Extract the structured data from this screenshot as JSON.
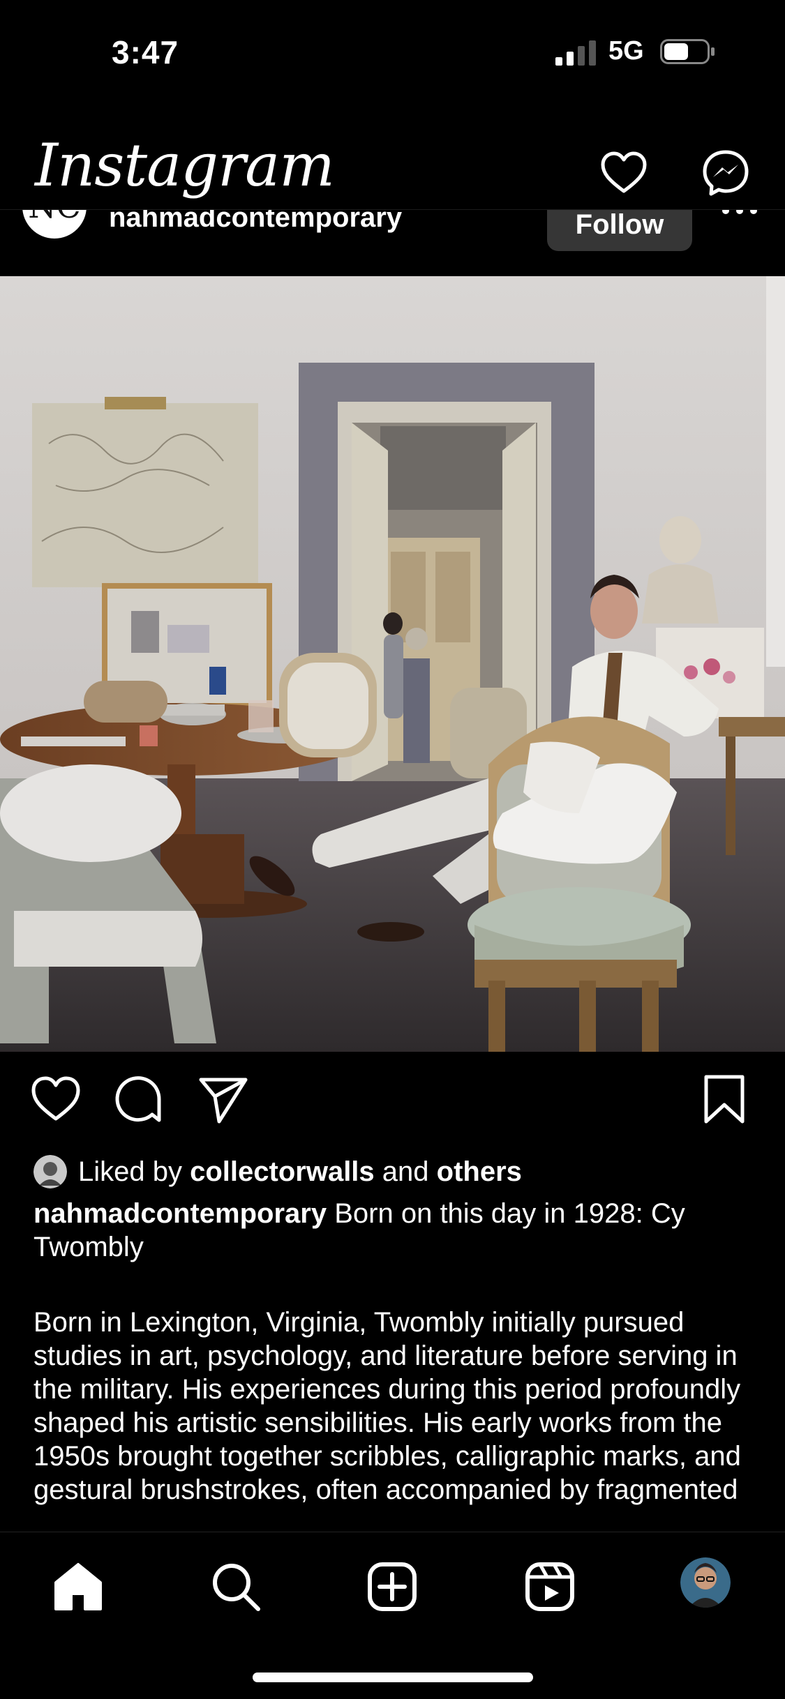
{
  "status": {
    "time": "3:47",
    "network": "5G"
  },
  "app": {
    "title": "Instagram"
  },
  "post": {
    "username": "nahmadcontemporary",
    "avatar_initials": "NC",
    "follow_label": "Follow"
  },
  "likes": {
    "prefix": "Liked by",
    "first_liker": "collectorwalls",
    "conjunction": "and",
    "others": "others"
  },
  "caption": {
    "username": "nahmadcontemporary",
    "headline": "Born on this day in 1928: Cy Twombly",
    "body": "Born in Lexington, Virginia, Twombly initially pursued studies in art, psychology, and literature before serving in the military. His experiences during this period profoundly shaped his artistic sensibilities. His early works from the 1950s brought together scribbles, calligraphic marks, and gestural brushstrokes, often accompanied by fragmented"
  }
}
